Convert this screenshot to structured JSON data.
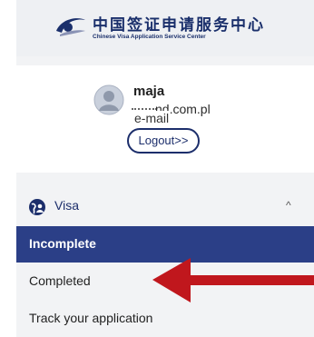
{
  "header": {
    "logo_cn": "中国签证申请服务中心",
    "logo_en": "Chinese Visa Application Service Center"
  },
  "user": {
    "name": "maja",
    "email_visible": "nd.com.pl",
    "email_annotation": "e-mail",
    "logout_label": "Logout>>"
  },
  "nav": {
    "section_label": "Visa",
    "section_icon": "globe-user-icon",
    "caret": "^",
    "items": [
      {
        "label": "Incomplete",
        "active": true
      },
      {
        "label": "Completed",
        "active": false
      },
      {
        "label": "Track your application",
        "active": false
      }
    ]
  },
  "colors": {
    "brand": "#1c2e6b",
    "active_bg": "#2b3f87",
    "arrow": "#c0171d"
  }
}
